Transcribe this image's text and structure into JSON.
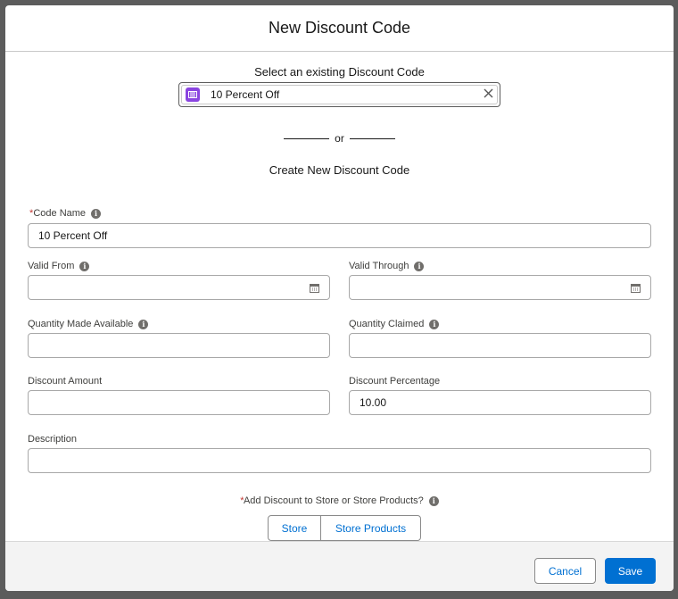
{
  "modal": {
    "title": "New Discount Code"
  },
  "existing": {
    "label": "Select an existing Discount Code",
    "value": "10 Percent Off",
    "icon": "discount-code-icon",
    "icon_color": "#8a45e0"
  },
  "divider": "or",
  "create_heading": "Create New Discount Code",
  "fields": {
    "code_name": {
      "label": "Code Name",
      "value": "10 Percent Off",
      "required": true
    },
    "valid_from": {
      "label": "Valid From",
      "value": ""
    },
    "valid_through": {
      "label": "Valid Through",
      "value": ""
    },
    "qty_available": {
      "label": "Quantity Made Available",
      "value": ""
    },
    "qty_claimed": {
      "label": "Quantity Claimed",
      "value": ""
    },
    "discount_amount": {
      "label": "Discount Amount",
      "value": ""
    },
    "discount_pct": {
      "label": "Discount Percentage",
      "value": "10.00"
    },
    "description": {
      "label": "Description",
      "value": ""
    }
  },
  "target": {
    "label": "Add Discount to Store or Store Products?",
    "required": true,
    "options": [
      "Store",
      "Store Products"
    ]
  },
  "footer": {
    "cancel": "Cancel",
    "save": "Save"
  },
  "colors": {
    "brand": "#0070d2",
    "required": "#c23934"
  }
}
